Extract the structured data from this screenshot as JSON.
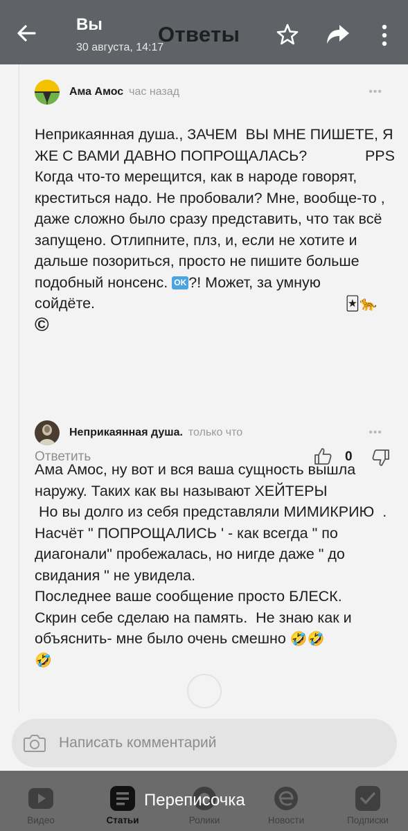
{
  "header": {
    "title": "Вы",
    "date": "30 августа, 14:17",
    "center_title": "Ответы",
    "back_icon": "arrow-left-icon",
    "star_icon": "star-outline-icon",
    "share_icon": "share-arrow-icon",
    "more_icon": "vertical-dots-icon"
  },
  "comments": [
    {
      "author": "Ама Амос",
      "time": "час назад",
      "text_main": "Неприкаянная душа., ЗАЧЕМ  ВЫ МНЕ ПИШЕТЕ, Я ЖЕ С ВАМИ ДАВНО ПОПРОЩАЛАСЬ?",
      "pps": "PPS",
      "text_cont": "Когда что-то мерещится, как в народе говорят, креститься надо. Не пробовали? Мне, вообще-то , даже сложно было сразу представить, что так всё запущено. Отлипните, плз, и, если не хотите и дальше позориться, просто не пишите больше подобный нонсенс.",
      "ok_label": "OK",
      "text_tail": "?! Может, за умную",
      "text_last": "сойдёте.",
      "emoji_joker": "🃏",
      "emoji_leopard": "🐆",
      "copyright": "©",
      "reply_label": "Ответить",
      "likes": "0"
    },
    {
      "author": "Неприкаянная душа.",
      "time": "только что",
      "text": "Ама Амос, ну вот и вся ваша сущность вышла наружу. Таких как вы называют ХЕЙТЕРЫ\n Но вы долго из себя представляли МИМИКРИЮ  .\nНасчёт \" ПОПРОЩАЛИСЬ ' - как всегда \" по диагонали\" пробежалась, но нигде даже \" до свидания \" не увидела.\nПоследнее ваше сообщение просто БЛЕСК.\nСкрин себе сделаю на память.  Не знаю как и объяснить- мне было очень смешно",
      "emoji_laugh": "🤣🤣",
      "emoji_laugh2": "🤣"
    }
  ],
  "compose": {
    "placeholder": "Написать комментарий",
    "icon": "camera-icon"
  },
  "nav": {
    "items": [
      {
        "label": "Видео",
        "icon": "video-play-icon"
      },
      {
        "label": "Статьи",
        "icon": "articles-icon",
        "active": true
      },
      {
        "label": "Ролики",
        "icon": "clips-icon"
      },
      {
        "label": "Новости",
        "icon": "news-icon"
      },
      {
        "label": "Подписки",
        "icon": "subscriptions-icon"
      }
    ]
  },
  "toast": "Переписочка",
  "colors": {
    "topbar": "#5f6266",
    "content_bg": "#f3f3f3",
    "muted_text": "#8e8e8e",
    "avatar_yellow": "#f2c200",
    "avatar_green": "#6fb14a"
  }
}
